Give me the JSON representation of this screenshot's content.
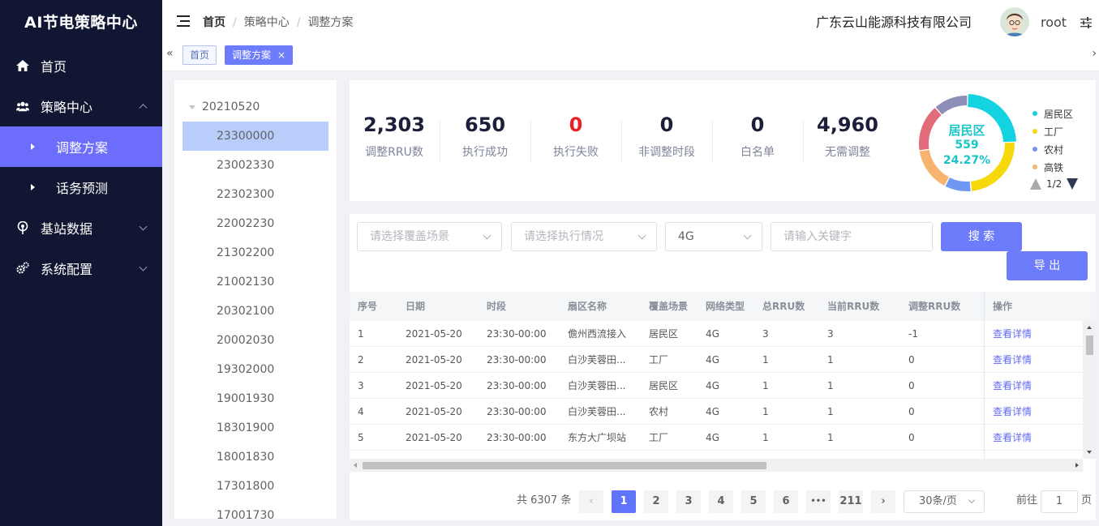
{
  "app_title": "AI节电策略中心",
  "sidebar": {
    "items": [
      {
        "label": "首页",
        "icon": "home-icon"
      },
      {
        "label": "策略中心",
        "icon": "users-icon",
        "expanded": true,
        "children": [
          {
            "label": "调整方案",
            "active": true
          },
          {
            "label": "话务预测"
          }
        ]
      },
      {
        "label": "基站数据",
        "icon": "signal-icon"
      },
      {
        "label": "系统配置",
        "icon": "gears-icon"
      }
    ]
  },
  "header": {
    "breadcrumbs": [
      "首页",
      "策略中心",
      "调整方案"
    ],
    "company": "广东云山能源科技有限公司",
    "username": "root"
  },
  "tags": [
    {
      "label": "首页"
    },
    {
      "label": "调整方案",
      "active": true,
      "close": "×"
    }
  ],
  "tags_nav": {
    "left": "«",
    "right": "›"
  },
  "tree": {
    "root": "20210520",
    "nodes": [
      "23300000",
      "23002330",
      "22302300",
      "22002230",
      "21302200",
      "21002130",
      "20302100",
      "20002030",
      "19302000",
      "19001930",
      "18301900",
      "18001830",
      "17301800",
      "17001730"
    ],
    "selected": "23300000"
  },
  "stats": [
    {
      "value": "2,303",
      "label": "调整RRU数"
    },
    {
      "value": "650",
      "label": "执行成功"
    },
    {
      "value": "0",
      "label": "执行失败",
      "color": "#e8202a"
    },
    {
      "value": "0",
      "label": "非调整时段"
    },
    {
      "value": "0",
      "label": "白名单"
    },
    {
      "value": "4,960",
      "label": "无需调整"
    }
  ],
  "donut": {
    "center_label": "居民区",
    "center_value": "559",
    "center_percent": "24.27%",
    "legend": [
      {
        "name": "居民区",
        "color": "#13d3e0"
      },
      {
        "name": "工厂",
        "color": "#f5d90a"
      },
      {
        "name": "农村",
        "color": "#6f97f3"
      },
      {
        "name": "高铁",
        "color": "#f7b46e"
      }
    ],
    "segment_colors": [
      "#13d3e0",
      "#f5d90a",
      "#6f97f3",
      "#f7b46e",
      "#e36c7a",
      "#8d8fb8"
    ],
    "segment_shares": [
      0.2427,
      0.24,
      0.09,
      0.15,
      0.16,
      0.1173
    ],
    "legend_page": "1/2"
  },
  "filters": {
    "scene_placeholder": "请选择覆盖场景",
    "status_placeholder": "请选择执行情况",
    "network_value": "4G",
    "keyword_placeholder": "请输入关键字",
    "search_label": "搜 索",
    "export_label": "导 出"
  },
  "table": {
    "columns": [
      "序号",
      "日期",
      "时段",
      "扇区名称",
      "覆盖场景",
      "网络类型",
      "总RRU数",
      "当前RRU数",
      "调整RRU数",
      "操作"
    ],
    "rows": [
      [
        "1",
        "2021-05-20",
        "23:30-00:00",
        "儋州西流接入",
        "居民区",
        "4G",
        "3",
        "3",
        "-1",
        "查看详情"
      ],
      [
        "2",
        "2021-05-20",
        "23:30-00:00",
        "白沙芙蓉田...",
        "工厂",
        "4G",
        "1",
        "1",
        "0",
        "查看详情"
      ],
      [
        "3",
        "2021-05-20",
        "23:30-00:00",
        "白沙芙蓉田...",
        "居民区",
        "4G",
        "1",
        "1",
        "0",
        "查看详情"
      ],
      [
        "4",
        "2021-05-20",
        "23:30-00:00",
        "白沙芙蓉田...",
        "农村",
        "4G",
        "1",
        "1",
        "0",
        "查看详情"
      ],
      [
        "5",
        "2021-05-20",
        "23:30-00:00",
        "东方大广坝站",
        "工厂",
        "4G",
        "1",
        "1",
        "0",
        "查看详情"
      ]
    ]
  },
  "pagination": {
    "total_text": "共 6307 条",
    "prev": "‹",
    "next": "›",
    "pages": [
      "1",
      "2",
      "3",
      "4",
      "5",
      "6",
      "•••",
      "211"
    ],
    "current": "1",
    "page_size": "30条/页",
    "goto_label": "前往",
    "goto_value": "1",
    "goto_unit": "页"
  },
  "colors": {
    "sidebar_bg": "#111633",
    "accent": "#6c7cfb",
    "active_nav": "#6c6dfb",
    "danger": "#e8202a"
  }
}
